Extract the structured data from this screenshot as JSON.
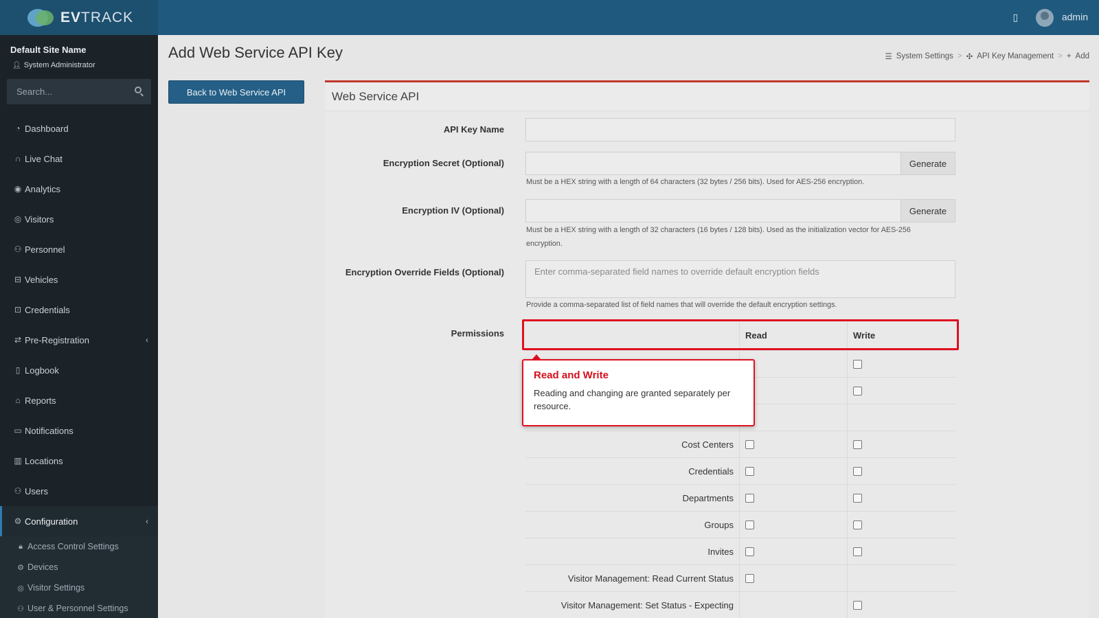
{
  "app": {
    "logo_prefix": "EV",
    "logo_suffix": "TRACK"
  },
  "topbar": {
    "building_icon": "building-icon",
    "user_name": "admin"
  },
  "sidebar": {
    "site_name": "Default Site Name",
    "role": "System Administrator",
    "search_placeholder": "Search...",
    "items": [
      {
        "label": "Dashboard",
        "icon": "dashboard-icon"
      },
      {
        "label": "Live Chat",
        "icon": "headset-icon"
      },
      {
        "label": "Analytics",
        "icon": "analytics-icon"
      },
      {
        "label": "Visitors",
        "icon": "eye-icon"
      },
      {
        "label": "Personnel",
        "icon": "personnel-icon"
      },
      {
        "label": "Vehicles",
        "icon": "car-icon"
      },
      {
        "label": "Credentials",
        "icon": "id-card-icon"
      },
      {
        "label": "Pre-Registration",
        "icon": "exchange-icon"
      },
      {
        "label": "Logbook",
        "icon": "book-icon"
      },
      {
        "label": "Reports",
        "icon": "chart-icon"
      },
      {
        "label": "Notifications",
        "icon": "chat-icon"
      },
      {
        "label": "Locations",
        "icon": "map-icon"
      },
      {
        "label": "Users",
        "icon": "users-icon"
      },
      {
        "label": "Configuration",
        "icon": "gear-icon"
      }
    ],
    "sub_items": [
      {
        "label": "Access Control Settings",
        "icon": "lock-icon"
      },
      {
        "label": "Devices",
        "icon": "cog-icon"
      },
      {
        "label": "Visitor Settings",
        "icon": "eye-icon"
      },
      {
        "label": "User & Personnel Settings",
        "icon": "users-icon"
      }
    ]
  },
  "page": {
    "title": "Add Web Service API Key",
    "back_label": "Back to Web Service API",
    "breadcrumb": [
      "System Settings",
      "API Key Management",
      "Add"
    ]
  },
  "panel": {
    "title": "Web Service API",
    "api_key_label": "API Key Name",
    "secret_label": "Encryption Secret (Optional)",
    "secret_help": "Must be a HEX string with a length of 64 characters (32 bytes / 256 bits). Used for AES-256 encryption.",
    "iv_label": "Encryption IV (Optional)",
    "iv_help_1": "Must be a HEX string with a length of 32 characters (16 bytes / 128 bits). Used as the initialization vector for AES-256",
    "iv_help_2": "encryption.",
    "generate_label": "Generate",
    "override_label": "Encryption Override Fields (Optional)",
    "override_placeholder": "Enter comma-separated field names to override default encryption fields",
    "override_help": "Provide a comma-separated list of field names that will override the default encryption settings.",
    "permissions_label": "Permissions"
  },
  "permissions": {
    "read_header": "Read",
    "write_header": "Write",
    "rows": [
      {
        "name": "",
        "read": true,
        "write": true
      },
      {
        "name": "",
        "read": false,
        "write": true
      },
      {
        "name": "",
        "read": false,
        "write": false
      },
      {
        "name": "Cost Centers",
        "read": true,
        "write": true
      },
      {
        "name": "Credentials",
        "read": true,
        "write": true
      },
      {
        "name": "Departments",
        "read": true,
        "write": true
      },
      {
        "name": "Groups",
        "read": true,
        "write": true
      },
      {
        "name": "Invites",
        "read": true,
        "write": true
      },
      {
        "name": "Visitor Management: Read Current Status",
        "read": true,
        "write": false
      },
      {
        "name": "Visitor Management: Set Status - Expecting",
        "read": false,
        "write": true
      }
    ]
  },
  "tooltip": {
    "title": "Read and Write",
    "body": "Reading and changing are granted separately per resource."
  }
}
